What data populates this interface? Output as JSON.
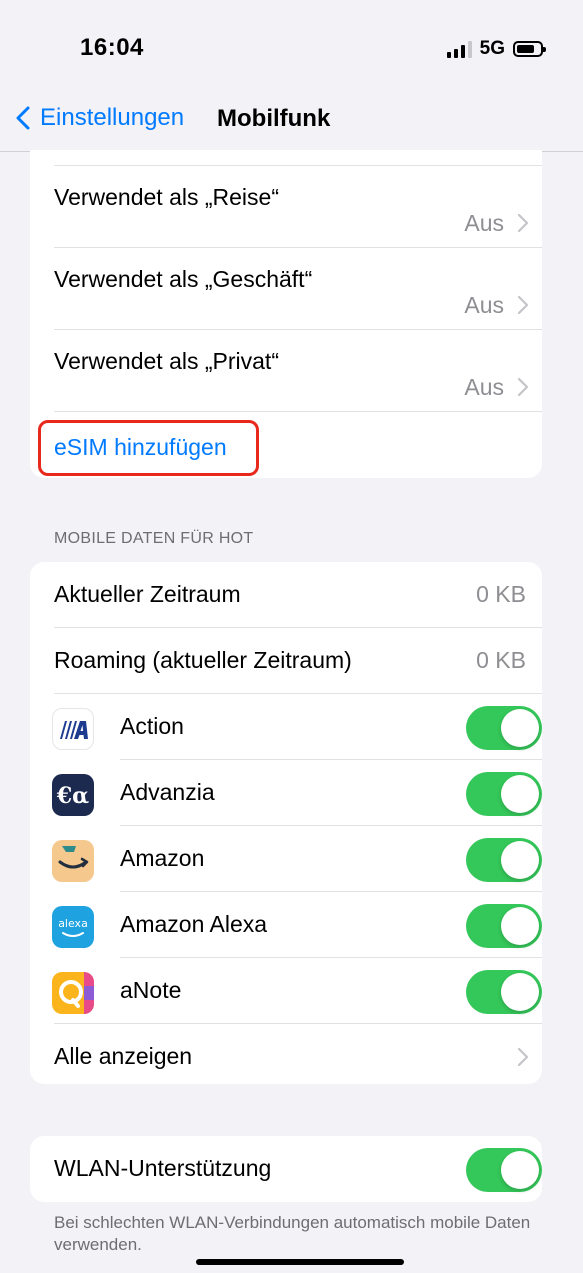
{
  "status_bar": {
    "time": "16:04",
    "network": "5G"
  },
  "nav": {
    "back_label": "Einstellungen",
    "title": "Mobilfunk"
  },
  "lines": [
    {
      "label": "Verwendet als „Reise“",
      "value": "Aus"
    },
    {
      "label": "Verwendet als „Geschäft“",
      "value": "Aus"
    },
    {
      "label": "Verwendet als „Privat“",
      "value": "Aus"
    }
  ],
  "add_esim_label": "eSIM hinzufügen",
  "data_section": {
    "header": "MOBILE DATEN FÜR HOT",
    "current_period": {
      "label": "Aktueller Zeitraum",
      "value": "0 KB"
    },
    "roaming": {
      "label": "Roaming (aktueller Zeitraum)",
      "value": "0 KB"
    },
    "apps": [
      {
        "name": "Action",
        "icon": "action-app-icon",
        "enabled": true
      },
      {
        "name": "Advanzia",
        "icon": "advanzia-app-icon",
        "enabled": true
      },
      {
        "name": "Amazon",
        "icon": "amazon-app-icon",
        "enabled": true
      },
      {
        "name": "Amazon Alexa",
        "icon": "alexa-app-icon",
        "enabled": true
      },
      {
        "name": "aNote",
        "icon": "anote-app-icon",
        "enabled": true
      }
    ],
    "show_all_label": "Alle anzeigen"
  },
  "wifi_assist": {
    "label": "WLAN-Unterstützung",
    "enabled": true,
    "footer": "Bei schlechten WLAN-Verbindungen automatisch mobile Daten verwenden."
  },
  "colors": {
    "accent": "#007aff",
    "toggle_on": "#34c759",
    "highlight": "#e8281a"
  }
}
